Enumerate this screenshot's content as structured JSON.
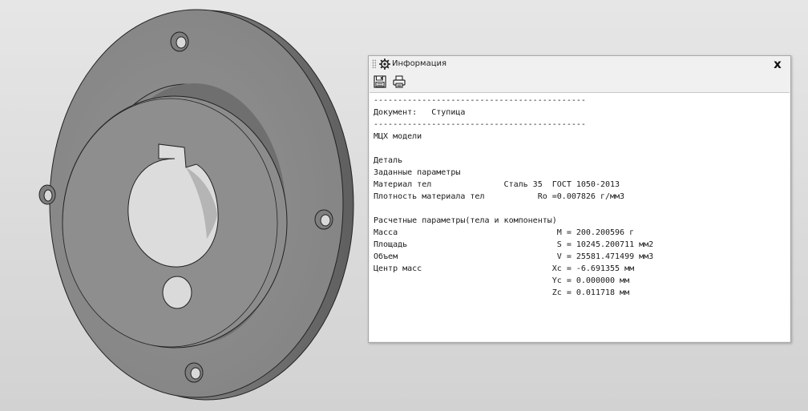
{
  "info_panel": {
    "title": "Информация",
    "close_label": "x",
    "toolbar": {
      "save_icon": "save-icon",
      "print_icon": "print-icon"
    },
    "report_lines": [
      "--------------------------------------------",
      "Документ:   Ступица",
      "--------------------------------------------",
      "МЦХ модели",
      "",
      "Деталь",
      "Заданные параметры",
      "Материал тел               Сталь 35  ГОСТ 1050-2013",
      "Плотность материала тел           Ro =0.007826 г/мм3",
      "",
      "Расчетные параметры(тела и компоненты)",
      "Масса                                 M = 200.200596 г",
      "Площадь                               S = 10245.200711 мм2",
      "Объем                                 V = 25581.471499 мм3",
      "Центр масс                           Xc = -6.691355 мм",
      "                                     Yc = 0.000000 мм",
      "                                     Zc = 0.011718 мм"
    ]
  },
  "colors": {
    "part_face": "#8a8a8a",
    "part_rim": "#6e6e6e",
    "bore": "#d8d8d8",
    "background": "#dcdcdc"
  }
}
